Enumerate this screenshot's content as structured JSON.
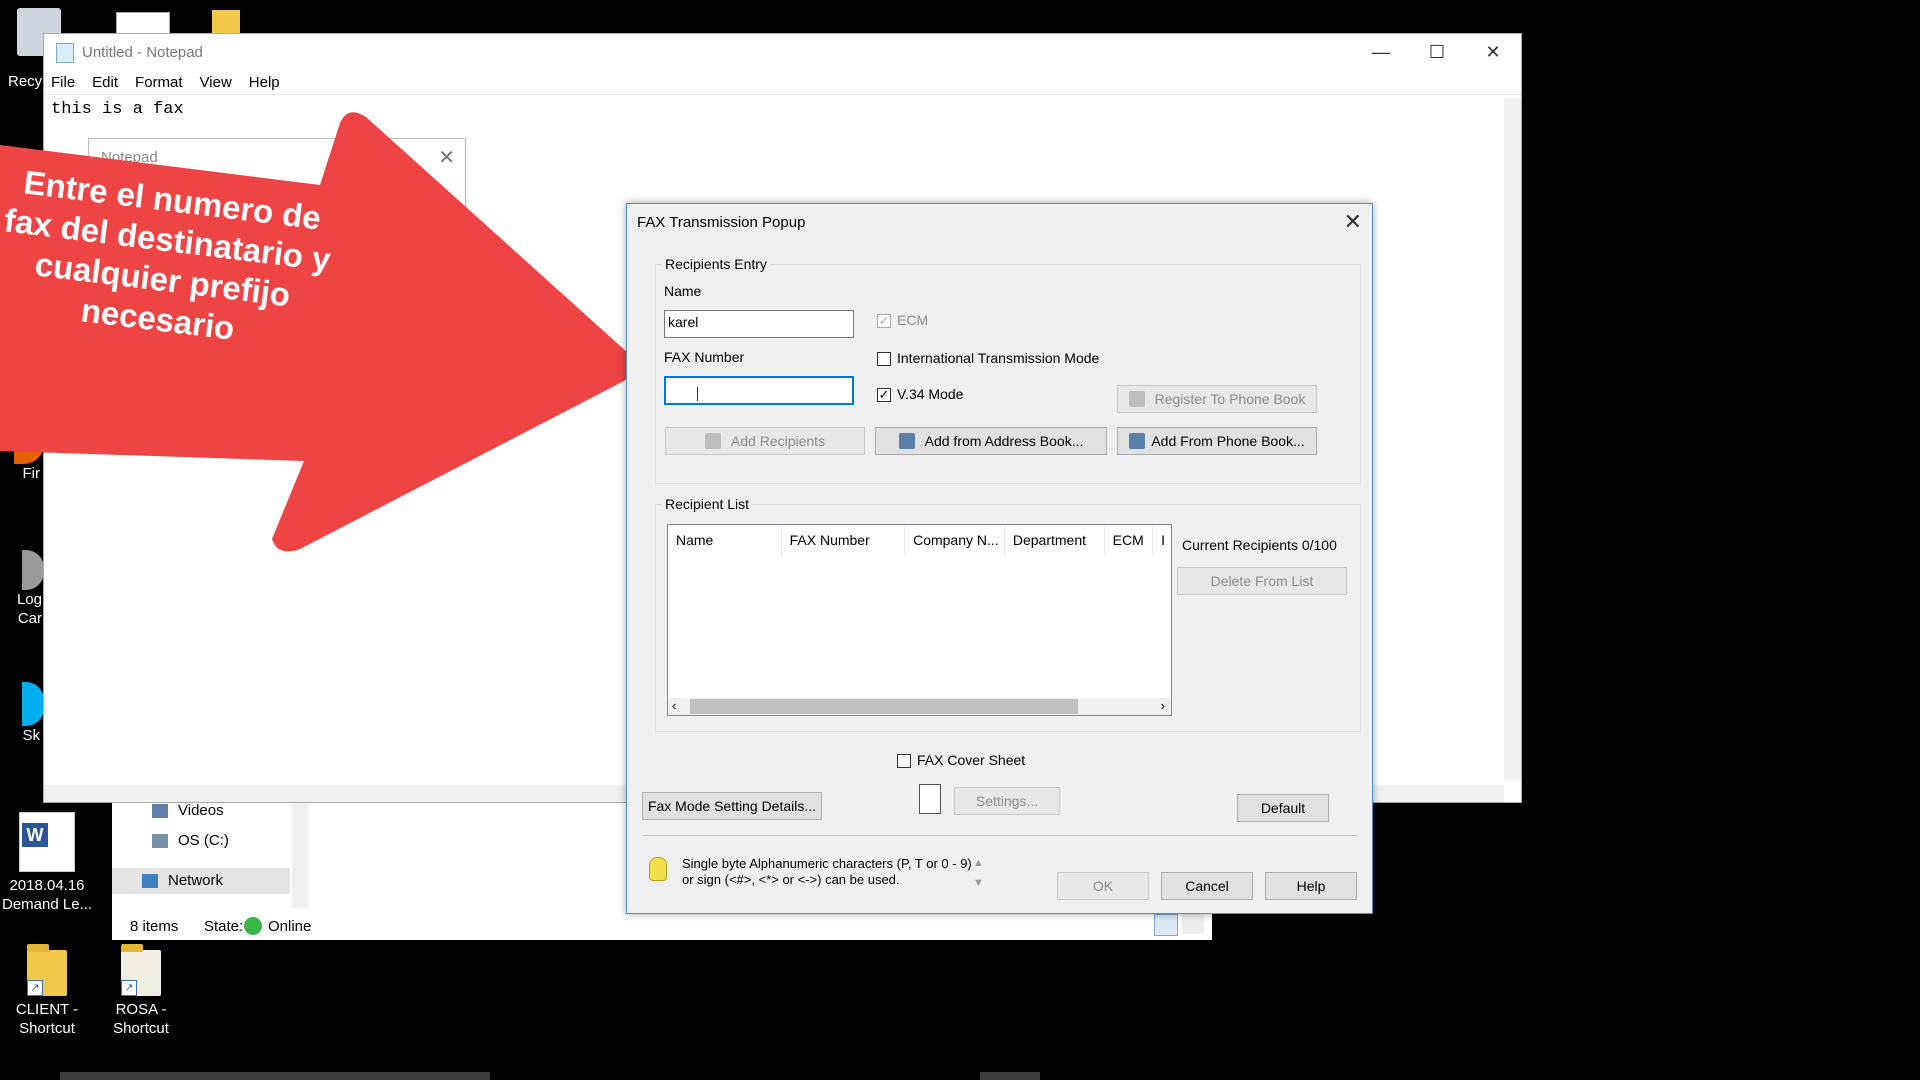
{
  "desktop": {
    "icons": [
      {
        "label": "Recy",
        "icon": "recycle-bin-icon"
      },
      {
        "label": "Fir",
        "icon": "firefox-icon"
      },
      {
        "label": "Log\nCar",
        "icon": "app-shortcut-icon"
      },
      {
        "label": "Sk",
        "icon": "skype-icon"
      },
      {
        "label": "2018.04.16\nDemand Le...",
        "icon": "word-doc-icon"
      },
      {
        "label": "CLIENT -\nShortcut",
        "icon": "folder-shortcut-icon"
      },
      {
        "label": "ROSA -\nShortcut",
        "icon": "folder-shortcut-icon"
      }
    ]
  },
  "notepad": {
    "title": "Untitled - Notepad",
    "menu": [
      "File",
      "Edit",
      "Format",
      "View",
      "Help"
    ],
    "content": "this is a fax",
    "controls": {
      "minimize": "—",
      "maximize": "☐",
      "close": "✕"
    }
  },
  "small_dialog": {
    "title": "Notepad",
    "close": "✕"
  },
  "explorer": {
    "nav": [
      {
        "label": "Videos",
        "icon": "videos-icon"
      },
      {
        "label": "OS (C:)",
        "icon": "drive-icon"
      },
      {
        "label": "Network",
        "icon": "network-icon"
      }
    ],
    "status_items": "8 items",
    "state_label": "State:",
    "state_value": "Online"
  },
  "overlay": {
    "text": "Entre el numero de fax del destinatario y cualquier prefijo necesario",
    "color": "#ef4444"
  },
  "fax": {
    "title": "FAX Transmission Popup",
    "close": "✕",
    "recipients_entry": {
      "legend": "Recipients Entry",
      "name_label": "Name",
      "name_value": "karel",
      "fax_label": "FAX Number",
      "fax_value": "",
      "ecm_label": "ECM",
      "intl_label": "International Transmission Mode",
      "v34_label": "V.34 Mode",
      "register_btn": "Register To Phone Book",
      "add_recipients_btn": "Add Recipients",
      "add_address_btn": "Add from Address Book...",
      "add_phone_btn": "Add From Phone Book..."
    },
    "recipient_list": {
      "legend": "Recipient List",
      "columns": [
        "Name",
        "FAX Number",
        "Company N...",
        "Department",
        "ECM",
        "I"
      ],
      "current_recipients": "Current Recipients 0/100",
      "delete_btn": "Delete From List"
    },
    "cover_sheet_label": "FAX Cover Sheet",
    "fax_mode_btn": "Fax Mode Setting Details...",
    "settings_btn": "Settings...",
    "default_btn": "Default",
    "tip": "Single byte Alphanumeric characters (P, T or 0 - 9) or sign (<#>, <*> or <->) can be used.",
    "ok_btn": "OK",
    "cancel_btn": "Cancel",
    "help_btn": "Help"
  }
}
